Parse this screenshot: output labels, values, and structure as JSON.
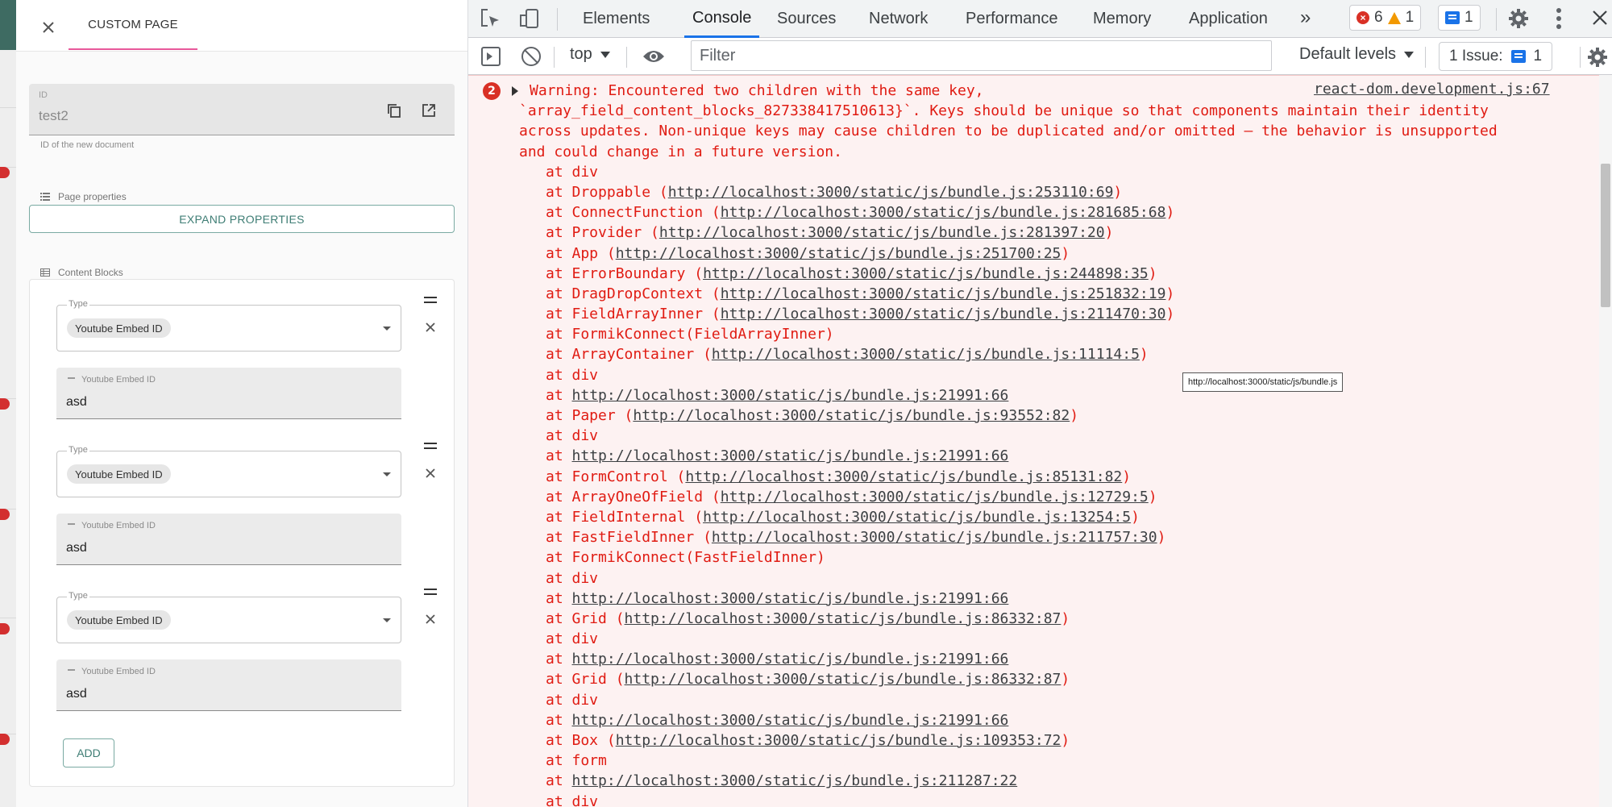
{
  "panel": {
    "tab_label": "CUSTOM PAGE",
    "id_field": {
      "label": "ID",
      "value": "test2",
      "helper": "ID of the new document"
    },
    "page_properties": {
      "title": "Page properties",
      "expand_label": "EXPAND PROPERTIES"
    },
    "content_blocks": {
      "title": "Content Blocks",
      "blocks": [
        {
          "type_label": "Type",
          "type_value": "Youtube Embed ID",
          "field_label": "Youtube Embed ID",
          "field_value": "asd"
        },
        {
          "type_label": "Type",
          "type_value": "Youtube Embed ID",
          "field_label": "Youtube Embed ID",
          "field_value": "asd"
        },
        {
          "type_label": "Type",
          "type_value": "Youtube Embed ID",
          "field_label": "Youtube Embed ID",
          "field_value": "asd"
        }
      ],
      "add_label": "ADD"
    }
  },
  "devtools": {
    "tabs": [
      "Elements",
      "Console",
      "Sources",
      "Network",
      "Performance",
      "Memory",
      "Application"
    ],
    "active_tab": "Console",
    "more_tabs": "»",
    "error_count": "6",
    "warning_count": "1",
    "info_count": "1",
    "toolbar": {
      "context": "top",
      "filter_placeholder": "Filter",
      "levels": "Default levels",
      "issues": "1 Issue:",
      "issues_count": "1"
    },
    "console": {
      "repeat_count": "2",
      "source": "react-dom.development.js:67",
      "message_lines": [
        "Warning: Encountered two children with the same key,",
        "`array_field_content_blocks_827338417510613}`. Keys should be unique so that components maintain their identity",
        "across updates. Non-unique keys may cause children to be duplicated and/or omitted — the behavior is unsupported",
        "and could change in a future version."
      ],
      "stack": [
        {
          "pre": "at div",
          "url": "",
          "post": ""
        },
        {
          "pre": "at Droppable (",
          "url": "http://localhost:3000/static/js/bundle.js:253110:69",
          "post": ")"
        },
        {
          "pre": "at ConnectFunction (",
          "url": "http://localhost:3000/static/js/bundle.js:281685:68",
          "post": ")"
        },
        {
          "pre": "at Provider (",
          "url": "http://localhost:3000/static/js/bundle.js:281397:20",
          "post": ")"
        },
        {
          "pre": "at App (",
          "url": "http://localhost:3000/static/js/bundle.js:251700:25",
          "post": ")"
        },
        {
          "pre": "at ErrorBoundary (",
          "url": "http://localhost:3000/static/js/bundle.js:244898:35",
          "post": ")"
        },
        {
          "pre": "at DragDropContext (",
          "url": "http://localhost:3000/static/js/bundle.js:251832:19",
          "post": ")"
        },
        {
          "pre": "at FieldArrayInner (",
          "url": "http://localhost:3000/static/js/bundle.js:211470:30",
          "post": ")"
        },
        {
          "pre": "at FormikConnect(FieldArrayInner)",
          "url": "",
          "post": ""
        },
        {
          "pre": "at ArrayContainer (",
          "url": "http://localhost:3000/static/js/bundle.js:11114:5",
          "post": ")"
        },
        {
          "pre": "at div",
          "url": "",
          "post": ""
        },
        {
          "pre": "at ",
          "url": "http://localhost:3000/static/js/bundle.js:21991:66",
          "post": ""
        },
        {
          "pre": "at Paper (",
          "url": "http://localhost:3000/static/js/bundle.js:93552:82",
          "post": ")"
        },
        {
          "pre": "at div",
          "url": "",
          "post": ""
        },
        {
          "pre": "at ",
          "url": "http://localhost:3000/static/js/bundle.js:21991:66",
          "post": ""
        },
        {
          "pre": "at FormControl (",
          "url": "http://localhost:3000/static/js/bundle.js:85131:82",
          "post": ")"
        },
        {
          "pre": "at ArrayOneOfField (",
          "url": "http://localhost:3000/static/js/bundle.js:12729:5",
          "post": ")"
        },
        {
          "pre": "at FieldInternal (",
          "url": "http://localhost:3000/static/js/bundle.js:13254:5",
          "post": ")"
        },
        {
          "pre": "at FastFieldInner (",
          "url": "http://localhost:3000/static/js/bundle.js:211757:30",
          "post": ")"
        },
        {
          "pre": "at FormikConnect(FastFieldInner)",
          "url": "",
          "post": ""
        },
        {
          "pre": "at div",
          "url": "",
          "post": ""
        },
        {
          "pre": "at ",
          "url": "http://localhost:3000/static/js/bundle.js:21991:66",
          "post": ""
        },
        {
          "pre": "at Grid (",
          "url": "http://localhost:3000/static/js/bundle.js:86332:87",
          "post": ")"
        },
        {
          "pre": "at div",
          "url": "",
          "post": ""
        },
        {
          "pre": "at ",
          "url": "http://localhost:3000/static/js/bundle.js:21991:66",
          "post": ""
        },
        {
          "pre": "at Grid (",
          "url": "http://localhost:3000/static/js/bundle.js:86332:87",
          "post": ")"
        },
        {
          "pre": "at div",
          "url": "",
          "post": ""
        },
        {
          "pre": "at ",
          "url": "http://localhost:3000/static/js/bundle.js:21991:66",
          "post": ""
        },
        {
          "pre": "at Box (",
          "url": "http://localhost:3000/static/js/bundle.js:109353:72",
          "post": ")"
        },
        {
          "pre": "at form",
          "url": "",
          "post": ""
        },
        {
          "pre": "at ",
          "url": "http://localhost:3000/static/js/bundle.js:211287:22",
          "post": ""
        },
        {
          "pre": "at div",
          "url": "",
          "post": ""
        }
      ],
      "tooltip": "http://localhost:3000/static/js/bundle.js"
    }
  },
  "colors": {
    "accent_pink": "#e8589a",
    "primary_teal": "#3e7d74",
    "error_red": "#e01b12",
    "console_bg": "#fdf2f2",
    "devtools_blue": "#1a73e8"
  }
}
